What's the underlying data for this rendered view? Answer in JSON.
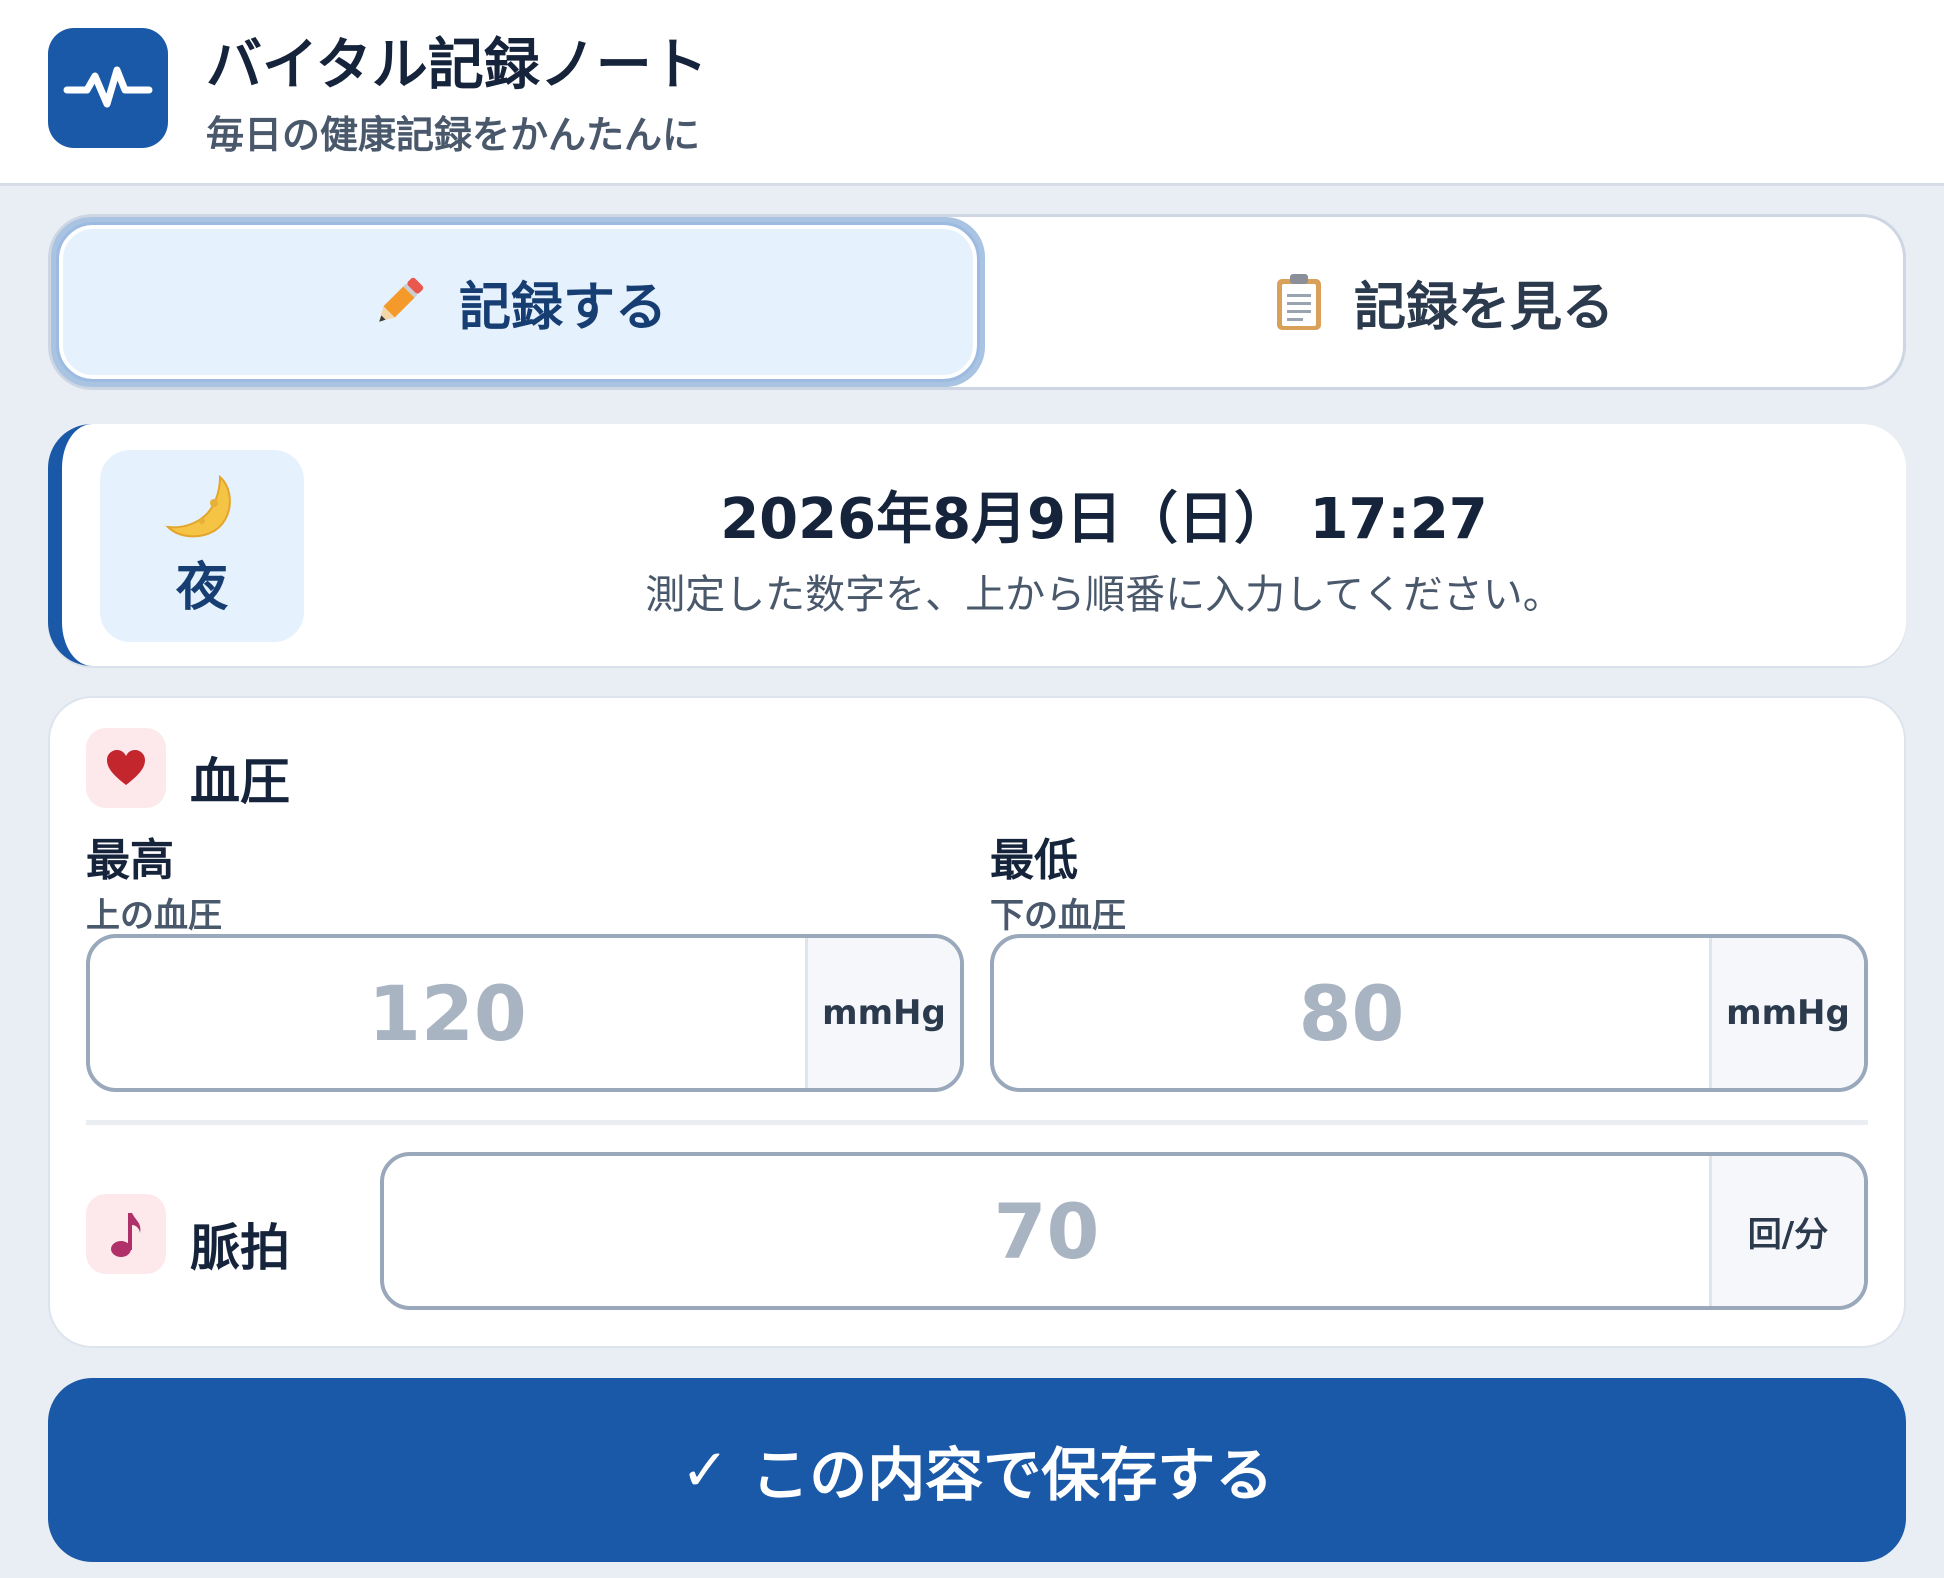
{
  "header": {
    "title": "バイタル記録ノート",
    "subtitle": "毎日の健康記録をかんたんに",
    "logo_icon": "pulse-icon"
  },
  "tabs": [
    {
      "label": "記録する",
      "icon": "pencil-icon",
      "active": true
    },
    {
      "label": "記録を見る",
      "icon": "clipboard-icon",
      "active": false
    }
  ],
  "session": {
    "period_icon": "crescent-moon-icon",
    "period_label": "夜",
    "datetime": "2026年8月9日（日） 17:27",
    "instruction": "測定した数字を、上から順番に入力してください。"
  },
  "blood_pressure": {
    "icon": "heart-icon",
    "title": "血圧",
    "systolic": {
      "label": "最高",
      "sublabel": "上の血圧",
      "placeholder": "120",
      "value": "",
      "unit": "mmHg"
    },
    "diastolic": {
      "label": "最低",
      "sublabel": "下の血圧",
      "placeholder": "80",
      "value": "",
      "unit": "mmHg"
    }
  },
  "pulse": {
    "icon": "music-note-icon",
    "title": "脈拍",
    "placeholder": "70",
    "value": "",
    "unit": "回/分"
  },
  "save": {
    "check": "✓",
    "label": "この内容で保存する"
  },
  "colors": {
    "primary": "#1a58a8",
    "background": "#e9eef5",
    "heart": "#c4262e",
    "note": "#b0306a"
  }
}
